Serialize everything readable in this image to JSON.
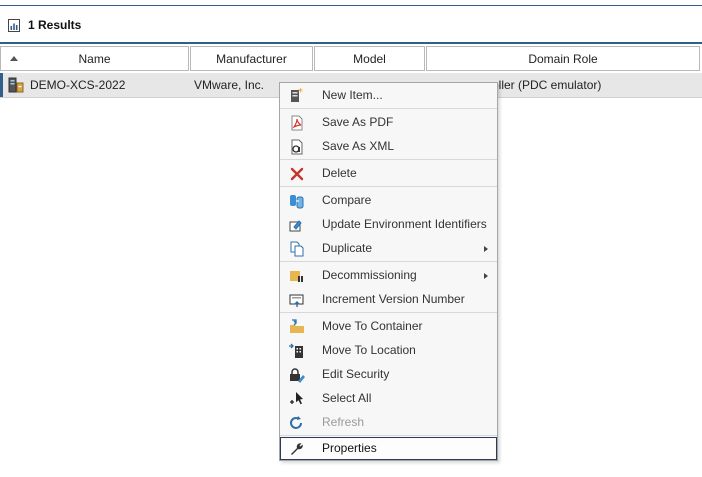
{
  "results": {
    "label": "1 Results",
    "icon": "report-icon"
  },
  "table": {
    "columns": [
      "Name",
      "Manufacturer",
      "Model",
      "Domain Role"
    ],
    "rows": [
      {
        "name": "DEMO-XCS-2022",
        "manufacturer": "VMware, Inc.",
        "model": "",
        "domain_role": "oller (PDC emulator)"
      }
    ]
  },
  "context_menu": {
    "items": [
      {
        "label": "New Item...",
        "icon": "new-item-icon"
      },
      {
        "label": "Save As PDF",
        "icon": "pdf-icon"
      },
      {
        "label": "Save As XML",
        "icon": "xml-icon"
      },
      {
        "label": "Delete",
        "icon": "delete-icon"
      },
      {
        "label": "Compare",
        "icon": "compare-icon"
      },
      {
        "label": "Update Environment Identifiers",
        "icon": "update-identifiers-icon"
      },
      {
        "label": "Duplicate",
        "icon": "duplicate-icon",
        "submenu": true
      },
      {
        "label": "Decommissioning",
        "icon": "decommission-icon",
        "submenu": true
      },
      {
        "label": "Increment Version Number",
        "icon": "increment-version-icon"
      },
      {
        "label": "Move To Container",
        "icon": "move-container-icon"
      },
      {
        "label": "Move To Location",
        "icon": "move-location-icon"
      },
      {
        "label": "Edit Security",
        "icon": "edit-security-icon"
      },
      {
        "label": "Select All",
        "icon": "select-all-icon"
      },
      {
        "label": "Refresh",
        "icon": "refresh-icon",
        "disabled": true
      },
      {
        "label": "Properties",
        "icon": "wrench-icon",
        "active": true
      }
    ]
  },
  "colors": {
    "accent": "#2f5f8a",
    "delete": "#c0392b",
    "pdf": "#d9352b",
    "folder": "#e8b650"
  }
}
